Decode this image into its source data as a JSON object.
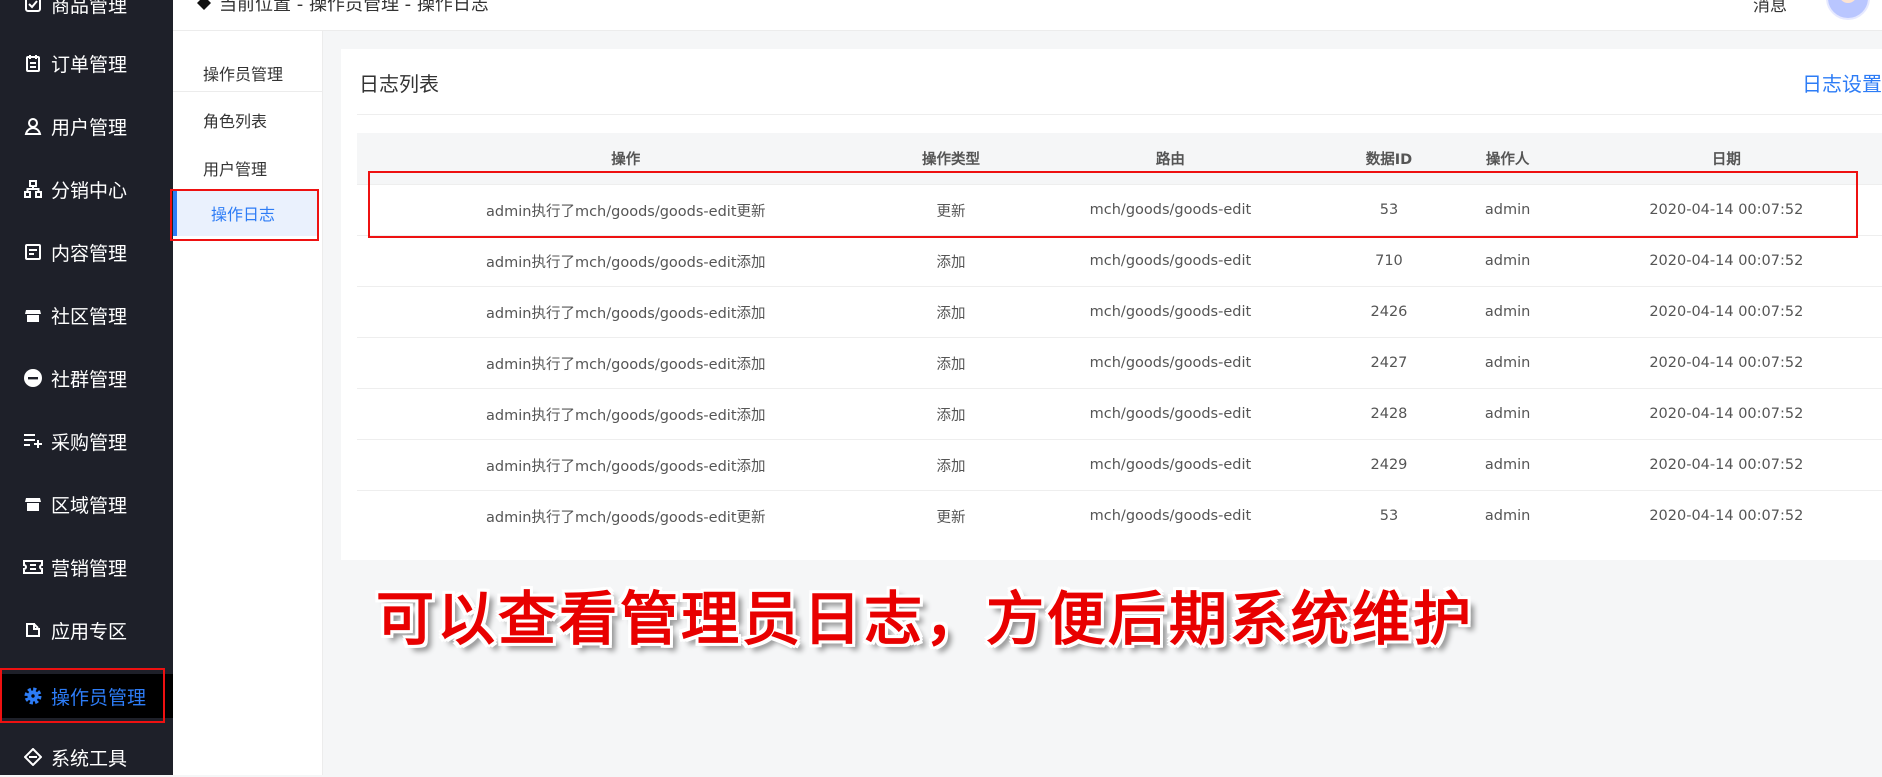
{
  "breadcrumb": "当前位置 - 操作员管理 - 操作日志",
  "header": {
    "message_label": "消息"
  },
  "sidebar": {
    "items": [
      {
        "label": "商品管理",
        "icon": "goods-icon"
      },
      {
        "label": "订单管理",
        "icon": "order-icon"
      },
      {
        "label": "用户管理",
        "icon": "user-icon"
      },
      {
        "label": "分销中心",
        "icon": "distribution-icon"
      },
      {
        "label": "内容管理",
        "icon": "content-icon"
      },
      {
        "label": "社区管理",
        "icon": "community-icon"
      },
      {
        "label": "社群管理",
        "icon": "group-icon"
      },
      {
        "label": "采购管理",
        "icon": "purchase-icon"
      },
      {
        "label": "区域管理",
        "icon": "region-icon"
      },
      {
        "label": "营销管理",
        "icon": "marketing-icon"
      },
      {
        "label": "应用专区",
        "icon": "apps-icon"
      },
      {
        "label": "操作员管理",
        "icon": "gear-icon"
      },
      {
        "label": "系统工具",
        "icon": "tools-icon"
      }
    ],
    "active_index": 11,
    "active_color": "#2d7cf6"
  },
  "submenu": {
    "title": "操作员管理",
    "items": [
      "角色列表",
      "用户管理",
      "操作日志"
    ],
    "active": "操作日志"
  },
  "card": {
    "title": "日志列表",
    "settings_link": "日志设置"
  },
  "table": {
    "columns": [
      "操作",
      "操作类型",
      "路由",
      "数据ID",
      "操作人",
      "日期"
    ],
    "rows": [
      [
        "admin执行了mch/goods/goods-edit更新",
        "更新",
        "mch/goods/goods-edit",
        "53",
        "admin",
        "2020-04-14 00:07:52"
      ],
      [
        "admin执行了mch/goods/goods-edit添加",
        "添加",
        "mch/goods/goods-edit",
        "710",
        "admin",
        "2020-04-14 00:07:52"
      ],
      [
        "admin执行了mch/goods/goods-edit添加",
        "添加",
        "mch/goods/goods-edit",
        "2426",
        "admin",
        "2020-04-14 00:07:52"
      ],
      [
        "admin执行了mch/goods/goods-edit添加",
        "添加",
        "mch/goods/goods-edit",
        "2427",
        "admin",
        "2020-04-14 00:07:52"
      ],
      [
        "admin执行了mch/goods/goods-edit添加",
        "添加",
        "mch/goods/goods-edit",
        "2428",
        "admin",
        "2020-04-14 00:07:52"
      ],
      [
        "admin执行了mch/goods/goods-edit添加",
        "添加",
        "mch/goods/goods-edit",
        "2429",
        "admin",
        "2020-04-14 00:07:52"
      ],
      [
        "admin执行了mch/goods/goods-edit更新",
        "更新",
        "mch/goods/goods-edit",
        "53",
        "admin",
        "2020-04-14 00:07:52"
      ]
    ]
  },
  "caption": "可以查看管理员日志，方便后期系统维护",
  "highlight_color": "#e11111"
}
